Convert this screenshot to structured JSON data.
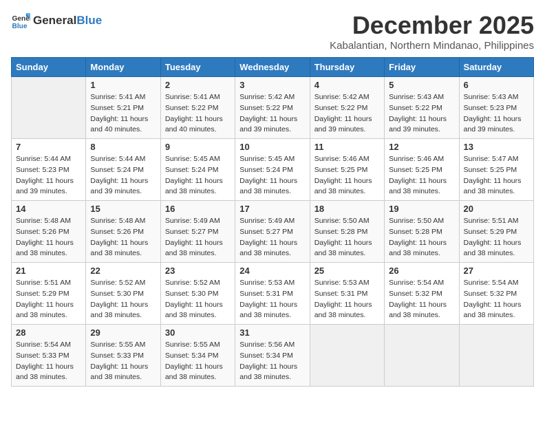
{
  "header": {
    "logo_general": "General",
    "logo_blue": "Blue",
    "month": "December 2025",
    "location": "Kabalantian, Northern Mindanao, Philippines"
  },
  "weekdays": [
    "Sunday",
    "Monday",
    "Tuesday",
    "Wednesday",
    "Thursday",
    "Friday",
    "Saturday"
  ],
  "weeks": [
    [
      {
        "day": "",
        "sunrise": "",
        "sunset": "",
        "daylight": ""
      },
      {
        "day": "1",
        "sunrise": "Sunrise: 5:41 AM",
        "sunset": "Sunset: 5:21 PM",
        "daylight": "Daylight: 11 hours and 40 minutes."
      },
      {
        "day": "2",
        "sunrise": "Sunrise: 5:41 AM",
        "sunset": "Sunset: 5:22 PM",
        "daylight": "Daylight: 11 hours and 40 minutes."
      },
      {
        "day": "3",
        "sunrise": "Sunrise: 5:42 AM",
        "sunset": "Sunset: 5:22 PM",
        "daylight": "Daylight: 11 hours and 39 minutes."
      },
      {
        "day": "4",
        "sunrise": "Sunrise: 5:42 AM",
        "sunset": "Sunset: 5:22 PM",
        "daylight": "Daylight: 11 hours and 39 minutes."
      },
      {
        "day": "5",
        "sunrise": "Sunrise: 5:43 AM",
        "sunset": "Sunset: 5:22 PM",
        "daylight": "Daylight: 11 hours and 39 minutes."
      },
      {
        "day": "6",
        "sunrise": "Sunrise: 5:43 AM",
        "sunset": "Sunset: 5:23 PM",
        "daylight": "Daylight: 11 hours and 39 minutes."
      }
    ],
    [
      {
        "day": "7",
        "sunrise": "Sunrise: 5:44 AM",
        "sunset": "Sunset: 5:23 PM",
        "daylight": "Daylight: 11 hours and 39 minutes."
      },
      {
        "day": "8",
        "sunrise": "Sunrise: 5:44 AM",
        "sunset": "Sunset: 5:24 PM",
        "daylight": "Daylight: 11 hours and 39 minutes."
      },
      {
        "day": "9",
        "sunrise": "Sunrise: 5:45 AM",
        "sunset": "Sunset: 5:24 PM",
        "daylight": "Daylight: 11 hours and 38 minutes."
      },
      {
        "day": "10",
        "sunrise": "Sunrise: 5:45 AM",
        "sunset": "Sunset: 5:24 PM",
        "daylight": "Daylight: 11 hours and 38 minutes."
      },
      {
        "day": "11",
        "sunrise": "Sunrise: 5:46 AM",
        "sunset": "Sunset: 5:25 PM",
        "daylight": "Daylight: 11 hours and 38 minutes."
      },
      {
        "day": "12",
        "sunrise": "Sunrise: 5:46 AM",
        "sunset": "Sunset: 5:25 PM",
        "daylight": "Daylight: 11 hours and 38 minutes."
      },
      {
        "day": "13",
        "sunrise": "Sunrise: 5:47 AM",
        "sunset": "Sunset: 5:25 PM",
        "daylight": "Daylight: 11 hours and 38 minutes."
      }
    ],
    [
      {
        "day": "14",
        "sunrise": "Sunrise: 5:48 AM",
        "sunset": "Sunset: 5:26 PM",
        "daylight": "Daylight: 11 hours and 38 minutes."
      },
      {
        "day": "15",
        "sunrise": "Sunrise: 5:48 AM",
        "sunset": "Sunset: 5:26 PM",
        "daylight": "Daylight: 11 hours and 38 minutes."
      },
      {
        "day": "16",
        "sunrise": "Sunrise: 5:49 AM",
        "sunset": "Sunset: 5:27 PM",
        "daylight": "Daylight: 11 hours and 38 minutes."
      },
      {
        "day": "17",
        "sunrise": "Sunrise: 5:49 AM",
        "sunset": "Sunset: 5:27 PM",
        "daylight": "Daylight: 11 hours and 38 minutes."
      },
      {
        "day": "18",
        "sunrise": "Sunrise: 5:50 AM",
        "sunset": "Sunset: 5:28 PM",
        "daylight": "Daylight: 11 hours and 38 minutes."
      },
      {
        "day": "19",
        "sunrise": "Sunrise: 5:50 AM",
        "sunset": "Sunset: 5:28 PM",
        "daylight": "Daylight: 11 hours and 38 minutes."
      },
      {
        "day": "20",
        "sunrise": "Sunrise: 5:51 AM",
        "sunset": "Sunset: 5:29 PM",
        "daylight": "Daylight: 11 hours and 38 minutes."
      }
    ],
    [
      {
        "day": "21",
        "sunrise": "Sunrise: 5:51 AM",
        "sunset": "Sunset: 5:29 PM",
        "daylight": "Daylight: 11 hours and 38 minutes."
      },
      {
        "day": "22",
        "sunrise": "Sunrise: 5:52 AM",
        "sunset": "Sunset: 5:30 PM",
        "daylight": "Daylight: 11 hours and 38 minutes."
      },
      {
        "day": "23",
        "sunrise": "Sunrise: 5:52 AM",
        "sunset": "Sunset: 5:30 PM",
        "daylight": "Daylight: 11 hours and 38 minutes."
      },
      {
        "day": "24",
        "sunrise": "Sunrise: 5:53 AM",
        "sunset": "Sunset: 5:31 PM",
        "daylight": "Daylight: 11 hours and 38 minutes."
      },
      {
        "day": "25",
        "sunrise": "Sunrise: 5:53 AM",
        "sunset": "Sunset: 5:31 PM",
        "daylight": "Daylight: 11 hours and 38 minutes."
      },
      {
        "day": "26",
        "sunrise": "Sunrise: 5:54 AM",
        "sunset": "Sunset: 5:32 PM",
        "daylight": "Daylight: 11 hours and 38 minutes."
      },
      {
        "day": "27",
        "sunrise": "Sunrise: 5:54 AM",
        "sunset": "Sunset: 5:32 PM",
        "daylight": "Daylight: 11 hours and 38 minutes."
      }
    ],
    [
      {
        "day": "28",
        "sunrise": "Sunrise: 5:54 AM",
        "sunset": "Sunset: 5:33 PM",
        "daylight": "Daylight: 11 hours and 38 minutes."
      },
      {
        "day": "29",
        "sunrise": "Sunrise: 5:55 AM",
        "sunset": "Sunset: 5:33 PM",
        "daylight": "Daylight: 11 hours and 38 minutes."
      },
      {
        "day": "30",
        "sunrise": "Sunrise: 5:55 AM",
        "sunset": "Sunset: 5:34 PM",
        "daylight": "Daylight: 11 hours and 38 minutes."
      },
      {
        "day": "31",
        "sunrise": "Sunrise: 5:56 AM",
        "sunset": "Sunset: 5:34 PM",
        "daylight": "Daylight: 11 hours and 38 minutes."
      },
      {
        "day": "",
        "sunrise": "",
        "sunset": "",
        "daylight": ""
      },
      {
        "day": "",
        "sunrise": "",
        "sunset": "",
        "daylight": ""
      },
      {
        "day": "",
        "sunrise": "",
        "sunset": "",
        "daylight": ""
      }
    ]
  ]
}
